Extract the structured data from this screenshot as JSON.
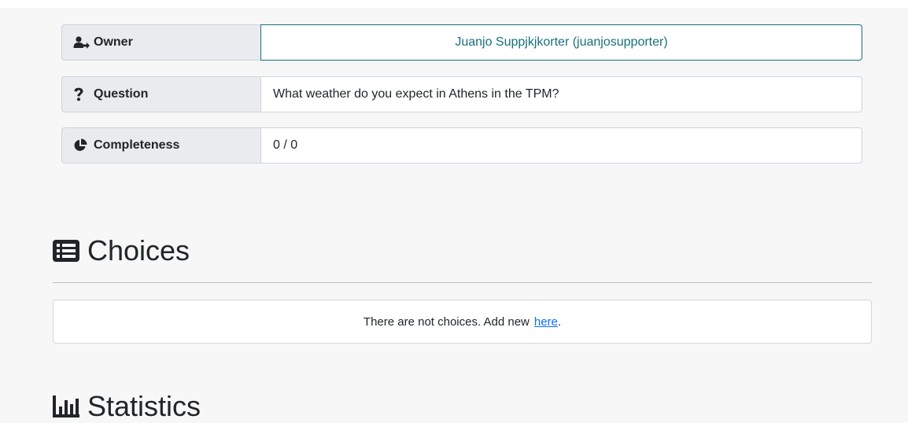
{
  "fields": {
    "owner": {
      "label": "Owner",
      "value": "Juanjo Suppjkjkorter (juanjosupporter)"
    },
    "question": {
      "label": "Question",
      "value": "What weather do you expect in Athens in the TPM?"
    },
    "completeness": {
      "label": "Completeness",
      "value": "0 / 0"
    }
  },
  "choices": {
    "title": "Choices",
    "empty_text": "There are not choices.  Add new",
    "link_text": "here",
    "trailing": "."
  },
  "statistics": {
    "title": "Statistics"
  },
  "colors": {
    "accent": "#17707e",
    "link": "#0d6efd",
    "label_bg": "#e9ecef",
    "page_bg": "#f7f7f7"
  },
  "icons": {
    "owner": "user-arrow-icon",
    "question": "question-mark-icon",
    "completeness": "pie-chart-icon",
    "choices": "list-icon",
    "statistics": "bar-chart-icon"
  }
}
